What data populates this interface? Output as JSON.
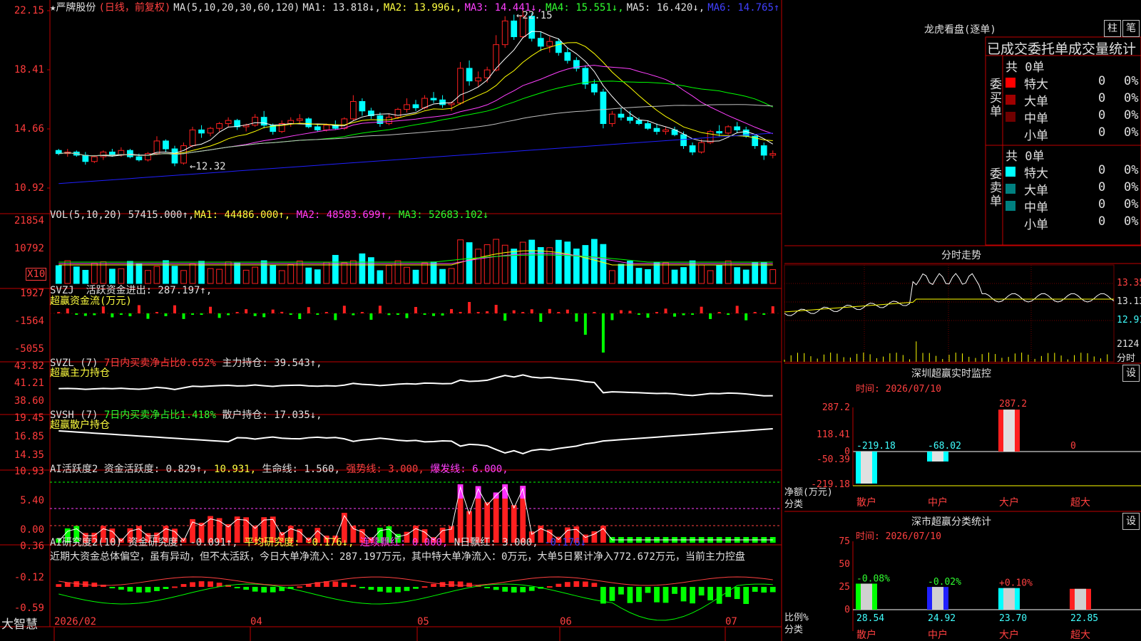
{
  "colors": {
    "up": "#ff2020",
    "down": "#00ffff",
    "grid": "#c00000",
    "ma1": "#ffffff",
    "ma2": "#ffff00",
    "ma3": "#ff40ff",
    "ma4": "#00ff00",
    "ma5": "#c0c0c0",
    "ma6": "#2020ff"
  },
  "main": {
    "header": {
      "star": "★",
      "name": "严牌股份",
      "mode": "(日线，前复权)",
      "ma_params": "MA(5,10,20,30,60,120)",
      "ma1": "MA1: 13.818↓,",
      "ma2": "MA2: 13.996↓,",
      "ma3": "MA3: 14.441↓,",
      "ma4": "MA4: 15.551↓,",
      "ma5": "MA5: 16.420↓,",
      "ma6": "MA6: 14.765↑"
    },
    "price_ticks": [
      "22.15",
      "18.41",
      "14.66",
      "10.92"
    ],
    "high_label": "22.15",
    "low_label": "12.32",
    "high_marker": "←22.15",
    "low_marker": "←12.32"
  },
  "vol": {
    "header": {
      "name": "VOL(5,10,20)",
      "val": "57415.000↑,",
      "ma1": "MA1: 44486.000↑,",
      "ma2": "MA2: 48583.699↑,",
      "ma3": "MA3: 52683.102↓"
    },
    "ticks": [
      "21854",
      "10792"
    ],
    "unit": "X10"
  },
  "svzj": {
    "header": {
      "name": "SVZJ",
      "t1": "活跃资金进出: 287.197↑,"
    },
    "sub": "超赢资金流(万元)",
    "ticks": [
      "1927",
      "-1564",
      "-5055"
    ]
  },
  "svzl": {
    "header": {
      "name": "SVZL (7)",
      "t1": "7日内买卖净占比0.652%",
      "t2": "主力持仓: 39.543↑,"
    },
    "sub": "超赢主力持仓",
    "ticks": [
      "43.82",
      "41.21",
      "38.60"
    ]
  },
  "svsh": {
    "header": {
      "name": "SVSH (7)",
      "t1": "7日内买卖净占比1.418%",
      "t2": "散户持仓: 17.035↓,"
    },
    "sub": "超赢散户持仓",
    "ticks": [
      "19.45",
      "16.85",
      "14.35"
    ]
  },
  "ai1": {
    "header": {
      "name": "AI活跃度2",
      "t1": "资金活跃度: 0.829↑,",
      "t2": "10.931,",
      "t3": "生命线: 1.560,",
      "t4": "强势线: 3.000,",
      "t5": "爆发线: 6.000,"
    },
    "ticks": [
      "10.93",
      "5.40",
      "0.00"
    ]
  },
  "ai2": {
    "header": {
      "name": "AI研究度2(10)",
      "t1": "资金研究度: -0.091↑,",
      "t2": "平均研究度: -0.176↓,",
      "t3": "连续飘红: 0.000,",
      "t4": "N日飘红: 3.000,",
      "t5": "-0.176↓"
    },
    "comment": "近期大资金总体偏空，虽有异动，但不太活跃，今日大单净流入：287.197万元，其中特大单净流入：0万元，大单5日累计净入772.672万元，当前主力控盘",
    "ticks": [
      "0.36",
      "-0.12",
      "-0.59"
    ]
  },
  "xaxis": {
    "brand": "大智慧",
    "labels": [
      "2026/02",
      "04",
      "05",
      "06",
      "07"
    ]
  },
  "lhb": {
    "title": "龙虎看盘(逐单)",
    "btn1": "柱",
    "btn2": "笔",
    "subtitle": "已成交委托单成交量统计",
    "buy_label": "委买单",
    "sell_label": "委卖单",
    "buy_total": "共 0单",
    "sell_total": "共 0单",
    "buy": [
      {
        "name": "特大",
        "n": "0",
        "p": "0%",
        "c": "#ff0000"
      },
      {
        "name": "大单",
        "n": "0",
        "p": "0%",
        "c": "#a00000"
      },
      {
        "name": "中单",
        "n": "0",
        "p": "0%",
        "c": "#700000"
      },
      {
        "name": "小单",
        "n": "0",
        "p": "0%",
        "c": ""
      }
    ],
    "sell": [
      {
        "name": "特大",
        "n": "0",
        "p": "0%",
        "c": "#00ffff"
      },
      {
        "name": "大单",
        "n": "0",
        "p": "0%",
        "c": "#008080"
      },
      {
        "name": "中单",
        "n": "0",
        "p": "0%",
        "c": "#008080"
      },
      {
        "name": "小单",
        "n": "0",
        "p": "0%",
        "c": ""
      }
    ]
  },
  "intraday": {
    "title": "分时走势",
    "ticks": [
      "13.35",
      "13.13",
      "12.91"
    ],
    "vol_tick": "2124",
    "vol_unit": "分时"
  },
  "rt": {
    "title": "深圳超赢实时监控",
    "btn": "设",
    "time": "时间: 2026/07/10",
    "ylabel": "净额(万元)",
    "xlabel": "分类",
    "ticks": [
      "287.2",
      "118.41",
      "0",
      "-50.39",
      "-219.18"
    ],
    "cats": [
      "散户",
      "中户",
      "大户",
      "超大"
    ],
    "values": [
      -219.18,
      -68.02,
      287.2,
      0
    ],
    "val_labels": [
      "-219.18",
      "-68.02",
      "287.2",
      "0"
    ]
  },
  "cls": {
    "title": "深市超赢分类统计",
    "btn": "设",
    "time": "时间: 2026/07/10",
    "ylabel": "比例%",
    "xlabel": "分类",
    "ticks": [
      "75",
      "50",
      "25",
      "0"
    ],
    "cats": [
      "散户",
      "中户",
      "大户",
      "超大"
    ],
    "values": [
      28.54,
      24.92,
      23.7,
      22.85
    ],
    "val_labels": [
      "28.54",
      "24.92",
      "23.70",
      "22.85"
    ],
    "changes": [
      "-0.08%",
      "-0.02%",
      "+0.10%",
      ""
    ]
  },
  "chart_data": {
    "type": "candlestick",
    "title": "严牌股份",
    "candles": [
      [
        13.3,
        13.4,
        13.0,
        13.1
      ],
      [
        13.1,
        13.4,
        12.9,
        13.2
      ],
      [
        13.2,
        13.3,
        12.9,
        13.0
      ],
      [
        13.0,
        13.2,
        12.4,
        12.6
      ],
      [
        12.6,
        13.0,
        12.5,
        12.9
      ],
      [
        12.9,
        13.3,
        12.7,
        13.2
      ],
      [
        13.2,
        13.4,
        12.9,
        13.0
      ],
      [
        13.0,
        13.5,
        12.9,
        13.3
      ],
      [
        13.3,
        13.4,
        12.8,
        12.9
      ],
      [
        12.9,
        13.1,
        12.6,
        12.7
      ],
      [
        12.7,
        13.2,
        12.6,
        13.1
      ],
      [
        13.1,
        14.2,
        13.0,
        13.9
      ],
      [
        13.9,
        14.0,
        13.2,
        13.4
      ],
      [
        13.4,
        13.6,
        12.3,
        12.5
      ],
      [
        12.5,
        13.8,
        12.4,
        13.6
      ],
      [
        13.6,
        14.8,
        13.5,
        14.6
      ],
      [
        14.6,
        14.9,
        14.1,
        14.4
      ],
      [
        14.4,
        14.8,
        14.2,
        14.7
      ],
      [
        14.7,
        15.1,
        14.5,
        15.0
      ],
      [
        15.0,
        15.4,
        14.8,
        15.2
      ],
      [
        15.2,
        15.3,
        14.6,
        14.8
      ],
      [
        14.8,
        15.0,
        14.5,
        14.9
      ],
      [
        14.9,
        15.6,
        14.8,
        15.4
      ],
      [
        15.4,
        15.8,
        14.7,
        14.9
      ],
      [
        14.9,
        15.0,
        14.3,
        14.5
      ],
      [
        14.5,
        15.2,
        14.4,
        15.0
      ],
      [
        15.0,
        15.4,
        14.8,
        15.2
      ],
      [
        15.2,
        15.6,
        15.0,
        15.3
      ],
      [
        15.3,
        15.4,
        14.7,
        14.8
      ],
      [
        14.8,
        15.0,
        14.5,
        14.6
      ],
      [
        14.6,
        15.0,
        14.5,
        14.9
      ],
      [
        14.9,
        15.2,
        14.6,
        14.7
      ],
      [
        14.7,
        15.4,
        14.6,
        15.3
      ],
      [
        15.3,
        16.8,
        15.2,
        16.4
      ],
      [
        16.4,
        16.6,
        15.5,
        15.8
      ],
      [
        15.8,
        16.0,
        15.3,
        15.5
      ],
      [
        15.5,
        15.7,
        14.8,
        15.0
      ],
      [
        15.0,
        15.6,
        14.9,
        15.4
      ],
      [
        15.4,
        16.0,
        15.3,
        15.9
      ],
      [
        15.9,
        16.6,
        15.7,
        16.2
      ],
      [
        16.2,
        16.5,
        15.8,
        16.0
      ],
      [
        16.0,
        16.8,
        15.9,
        16.6
      ],
      [
        16.6,
        17.0,
        16.3,
        16.5
      ],
      [
        16.5,
        16.8,
        16.0,
        16.2
      ],
      [
        16.2,
        16.4,
        15.8,
        16.3
      ],
      [
        16.3,
        18.9,
        16.2,
        18.5
      ],
      [
        18.5,
        19.0,
        17.4,
        17.7
      ],
      [
        17.7,
        18.3,
        17.3,
        17.9
      ],
      [
        17.9,
        18.6,
        17.6,
        18.4
      ],
      [
        18.4,
        20.6,
        18.3,
        20.0
      ],
      [
        20.0,
        21.8,
        19.8,
        21.5
      ],
      [
        21.5,
        21.9,
        20.3,
        20.5
      ],
      [
        20.5,
        22.15,
        20.4,
        21.8
      ],
      [
        21.8,
        22.0,
        20.2,
        20.4
      ],
      [
        20.4,
        20.8,
        19.6,
        19.9
      ],
      [
        19.9,
        20.5,
        19.5,
        20.2
      ],
      [
        20.2,
        20.4,
        19.3,
        19.5
      ],
      [
        19.5,
        19.8,
        18.8,
        19.0
      ],
      [
        19.0,
        19.2,
        18.3,
        18.5
      ],
      [
        18.5,
        18.7,
        17.2,
        17.5
      ],
      [
        17.5,
        17.8,
        16.8,
        17.0
      ],
      [
        17.0,
        17.2,
        14.7,
        15.0
      ],
      [
        15.0,
        15.8,
        14.8,
        15.6
      ],
      [
        15.6,
        16.0,
        15.2,
        15.4
      ],
      [
        15.4,
        15.8,
        15.0,
        15.2
      ],
      [
        15.2,
        15.4,
        14.9,
        15.0
      ],
      [
        15.0,
        15.2,
        14.6,
        14.7
      ],
      [
        14.7,
        15.0,
        14.3,
        14.5
      ],
      [
        14.5,
        14.8,
        14.3,
        14.6
      ],
      [
        14.6,
        14.8,
        14.2,
        14.3
      ],
      [
        14.3,
        14.5,
        13.4,
        13.6
      ],
      [
        13.6,
        13.8,
        13.0,
        13.2
      ],
      [
        13.2,
        14.0,
        13.1,
        13.8
      ],
      [
        13.8,
        14.6,
        13.7,
        14.5
      ],
      [
        14.5,
        14.9,
        14.2,
        14.4
      ],
      [
        14.4,
        14.9,
        14.3,
        14.8
      ],
      [
        14.8,
        15.1,
        14.4,
        14.6
      ],
      [
        14.6,
        14.8,
        14.1,
        14.2
      ],
      [
        14.2,
        14.3,
        13.4,
        13.6
      ],
      [
        13.6,
        13.8,
        12.7,
        13.0
      ],
      [
        13.0,
        13.3,
        12.8,
        13.1
      ]
    ],
    "ylim": [
      10.92,
      22.15
    ]
  }
}
